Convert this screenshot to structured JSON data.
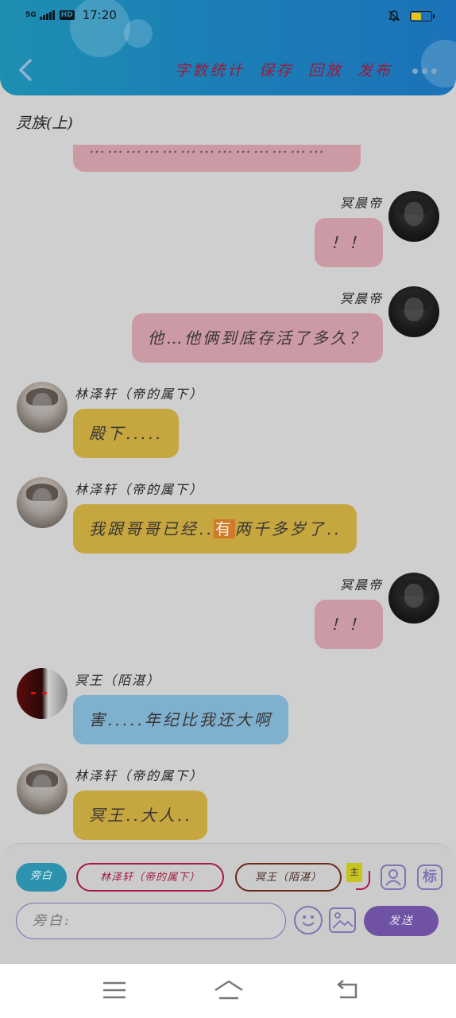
{
  "status_bar": {
    "network": "5G",
    "hd": "HD",
    "time": "17:20",
    "battery_level": 0.5
  },
  "toolbar": {
    "menu": [
      "字数统计",
      "保存",
      "回放",
      "发布"
    ]
  },
  "chat": {
    "title": "灵族(上)",
    "partial_message": "…………………………………",
    "messages": [
      {
        "sender": "冥晨帝",
        "side": "right",
        "avatar": "emperor",
        "text": "！！",
        "color": "pink"
      },
      {
        "sender": "冥晨帝",
        "side": "right",
        "avatar": "emperor",
        "text": "他…他俩到底存活了多久？",
        "color": "pink"
      },
      {
        "sender": "林泽轩（帝的属下）",
        "side": "left",
        "avatar": "lin",
        "text": "殿下.....",
        "color": "gold"
      },
      {
        "sender": "林泽轩（帝的属下）",
        "side": "left",
        "avatar": "lin",
        "text_before": "我跟哥哥已经..",
        "text_highlight": "有",
        "text_after": "两千多岁了..",
        "color": "gold"
      },
      {
        "sender": "冥晨帝",
        "side": "right",
        "avatar": "emperor",
        "text": "！！",
        "color": "pink"
      },
      {
        "sender": "冥王（陌湛）",
        "side": "left",
        "avatar": "ming",
        "text": "害.....年纪比我还大啊",
        "color": "blue"
      },
      {
        "sender": "林泽轩（帝的属下）",
        "side": "left",
        "avatar": "lin",
        "text": "冥王..大人..",
        "color": "gold"
      }
    ]
  },
  "input_panel": {
    "roles": [
      "旁白",
      "林泽轩（帝的属下）",
      "冥王（陌湛）"
    ],
    "master_tag": "主",
    "tag_label": "标",
    "input_placeholder": "旁白:",
    "send_label": "发送"
  },
  "colors": {
    "header": "#1c7fb6",
    "pink_bubble": "#cc9aa4",
    "gold_bubble": "#c6a63f",
    "blue_bubble": "#7fb1cf",
    "accent_purple": "#6f52a3"
  }
}
